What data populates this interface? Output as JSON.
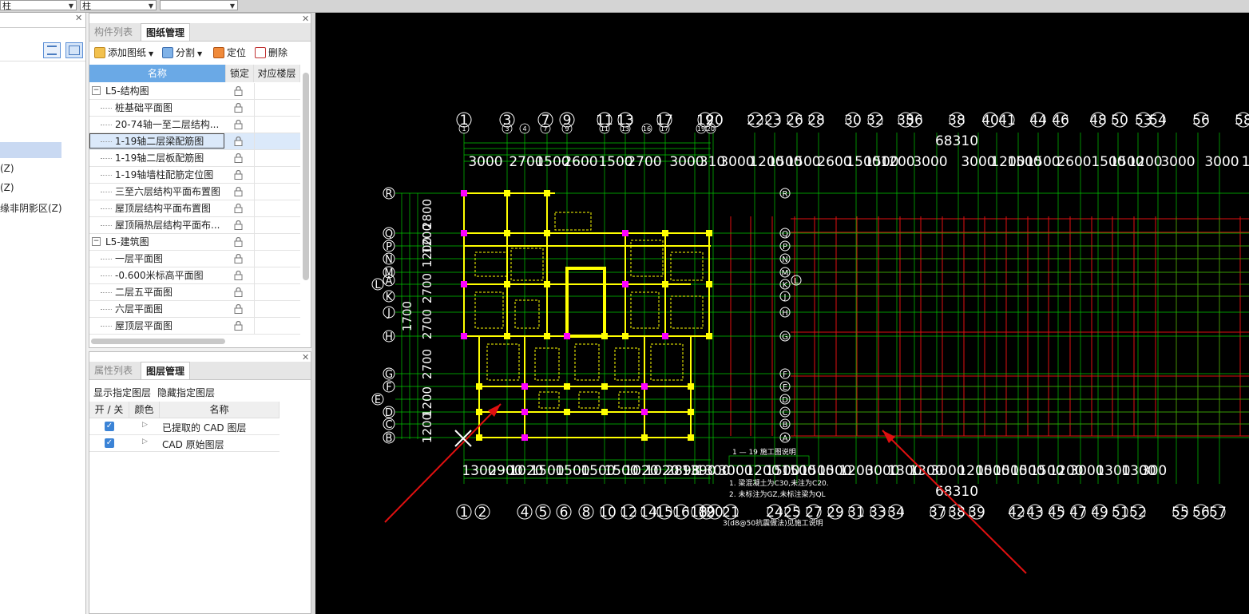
{
  "top_combos": [
    {
      "value": "柱"
    },
    {
      "value": "柱"
    },
    {
      "value": ""
    }
  ],
  "left_strip": {
    "items": [
      {
        "label": "(Z)"
      },
      {
        "label": "(Z)"
      },
      {
        "label": "缘非阴影区(Z)"
      }
    ]
  },
  "drawing_panel": {
    "tabs": [
      {
        "label": "构件列表",
        "active": false
      },
      {
        "label": "图纸管理",
        "active": true
      }
    ],
    "toolbar": {
      "add": "添加图纸",
      "split": "分割",
      "locate": "定位",
      "delete": "删除"
    },
    "columns": {
      "name": "名称",
      "lock": "锁定",
      "floor": "对应楼层"
    },
    "rows": [
      {
        "label": "L5-结构图",
        "group": true
      },
      {
        "label": "桩基础平面图"
      },
      {
        "label": "20-74轴一至二层结构..."
      },
      {
        "label": "1-19轴二层梁配筋图",
        "selected": true
      },
      {
        "label": "1-19轴二层板配筋图"
      },
      {
        "label": "1-19轴墙柱配筋定位图"
      },
      {
        "label": "三至六层结构平面布置图"
      },
      {
        "label": "屋顶层结构平面布置图"
      },
      {
        "label": "屋顶隔热层结构平面布..."
      },
      {
        "label": "L5-建筑图",
        "group": true
      },
      {
        "label": "一层平面图"
      },
      {
        "label": "-0.600米标高平面图"
      },
      {
        "label": "二层五平面图"
      },
      {
        "label": "六层平面图"
      },
      {
        "label": "屋顶层平面图"
      }
    ]
  },
  "layer_panel": {
    "tabs": [
      {
        "label": "属性列表",
        "active": false
      },
      {
        "label": "图层管理",
        "active": true
      }
    ],
    "show_label": "显示指定图层",
    "hide_label": "隐藏指定图层",
    "columns": {
      "toggle": "开 / 关",
      "color": "颜色",
      "name": "名称"
    },
    "rows": [
      {
        "name": "已提取的 CAD 图层",
        "on": true
      },
      {
        "name": "CAD 原始图层",
        "on": true
      }
    ]
  },
  "cad": {
    "top_axis_labels": [
      "1",
      "3",
      "7",
      "9",
      "11",
      "13",
      "17",
      "19",
      "20",
      "22",
      "23",
      "26",
      "28",
      "30",
      "32",
      "35",
      "36",
      "38",
      "40",
      "41",
      "44",
      "46",
      "48",
      "50",
      "53",
      "54",
      "56",
      "58"
    ],
    "top_sub_labels": [
      "1",
      "3",
      "4",
      "7",
      "9",
      "11",
      "13",
      "16",
      "17",
      "19",
      "20"
    ],
    "top_total": "68310",
    "top_dims": [
      "3000",
      "2700",
      "1500",
      "2600",
      "1500",
      "2700",
      "3000",
      "310",
      "3000",
      "1200",
      "1500",
      "1500",
      "2600",
      "1500",
      "1500",
      "1200",
      "3000",
      "3000",
      "1200",
      "1500",
      "1500",
      "2600",
      "1500",
      "1500",
      "1200",
      "3000",
      "3000",
      "1"
    ],
    "bottom_total": "68310",
    "bottom_dims": [
      "1300",
      "2900",
      "1020",
      "1500",
      "1500",
      "1500",
      "1500",
      "1020",
      "1020",
      "2898",
      "1390",
      "1300",
      "3000",
      "1200",
      "1500",
      "1500",
      "1500",
      "1500",
      "1200",
      "3000",
      "1300",
      "1300",
      "3000",
      "1200",
      "1500",
      "1500",
      "1500",
      "1500",
      "1200",
      "3000",
      "1300",
      "1300",
      "300"
    ],
    "bottom_axis_labels": [
      "1",
      "2",
      "4",
      "5",
      "6",
      "8",
      "10",
      "12",
      "14",
      "15",
      "16",
      "18",
      "19",
      "20",
      "21",
      "24",
      "25",
      "27",
      "29",
      "31",
      "33",
      "34",
      "37",
      "38",
      "39",
      "42",
      "43",
      "45",
      "47",
      "49",
      "51",
      "52",
      "55",
      "56",
      "57"
    ],
    "left_axis_labels": [
      "R",
      "Q",
      "P",
      "N",
      "M",
      "L",
      "K",
      "J",
      "H",
      "G",
      "F",
      "E",
      "D",
      "C",
      "B",
      "A"
    ],
    "right_axis_labels": [
      "R",
      "Q",
      "P",
      "N",
      "M",
      "K",
      "J",
      "H",
      "G",
      "F",
      "E",
      "D",
      "C",
      "B",
      "A",
      "L"
    ],
    "left_dims": [
      "2800",
      "1200",
      "1200",
      "2700",
      "2700",
      "1700",
      "2700",
      "1200",
      "1200"
    ],
    "notes": [
      "1. 梁混凝土为C30,未注为C20.",
      "2. 未标注为GZ,未标注梁为QL",
      "1 — 19 施工图说明",
      "3(d8@50抗震做法)见施工说明"
    ],
    "colors": {
      "green": "#00c800",
      "yellow": "#ffff00",
      "red": "#e01010",
      "magenta": "#ff00ff",
      "white": "#ffffff"
    }
  }
}
